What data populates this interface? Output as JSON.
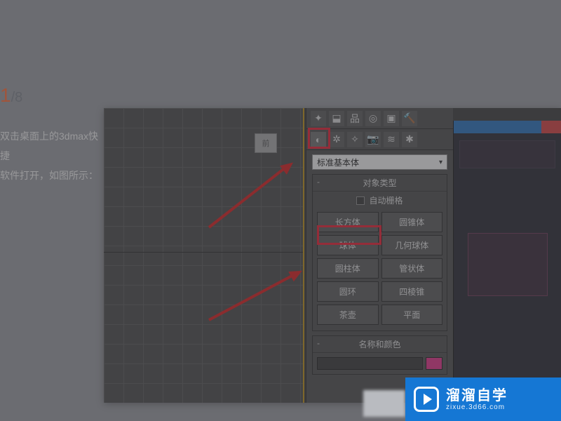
{
  "step": {
    "current": "1",
    "total": "/8"
  },
  "article": {
    "line1": "双击桌面上的3dmax快捷",
    "line2": "软件打开，如图所示："
  },
  "viewport": {
    "label": "前"
  },
  "panel": {
    "dropdown_value": "标准基本体",
    "rollout_objtype": "对象类型",
    "autogrid": "自动栅格",
    "buttons": {
      "box": "长方体",
      "cone": "圆锥体",
      "sphere": "球体",
      "geosphere": "几何球体",
      "cylinder": "圆柱体",
      "tube": "管状体",
      "torus": "圆环",
      "pyramid": "四棱锥",
      "teapot": "茶壶",
      "plane": "平面"
    },
    "rollout_namecolor": "名称和颜色"
  },
  "icons": {
    "top": [
      "sun-icon",
      "image-icon",
      "light-icon",
      "target-icon",
      "camera-icon",
      "hammer-icon"
    ],
    "sub": [
      "sphere-icon",
      "link-icon",
      "loft-icon",
      "nurbs-icon",
      "aec-icon",
      "wave-icon",
      "particle-icon"
    ]
  },
  "watermark": {
    "cn": "溜溜自学",
    "en": "zixue.3d66.com"
  },
  "colors": {
    "accent_red": "#d22",
    "panel_bg": "#4e4e4e",
    "brand_blue": "#1577d4"
  }
}
